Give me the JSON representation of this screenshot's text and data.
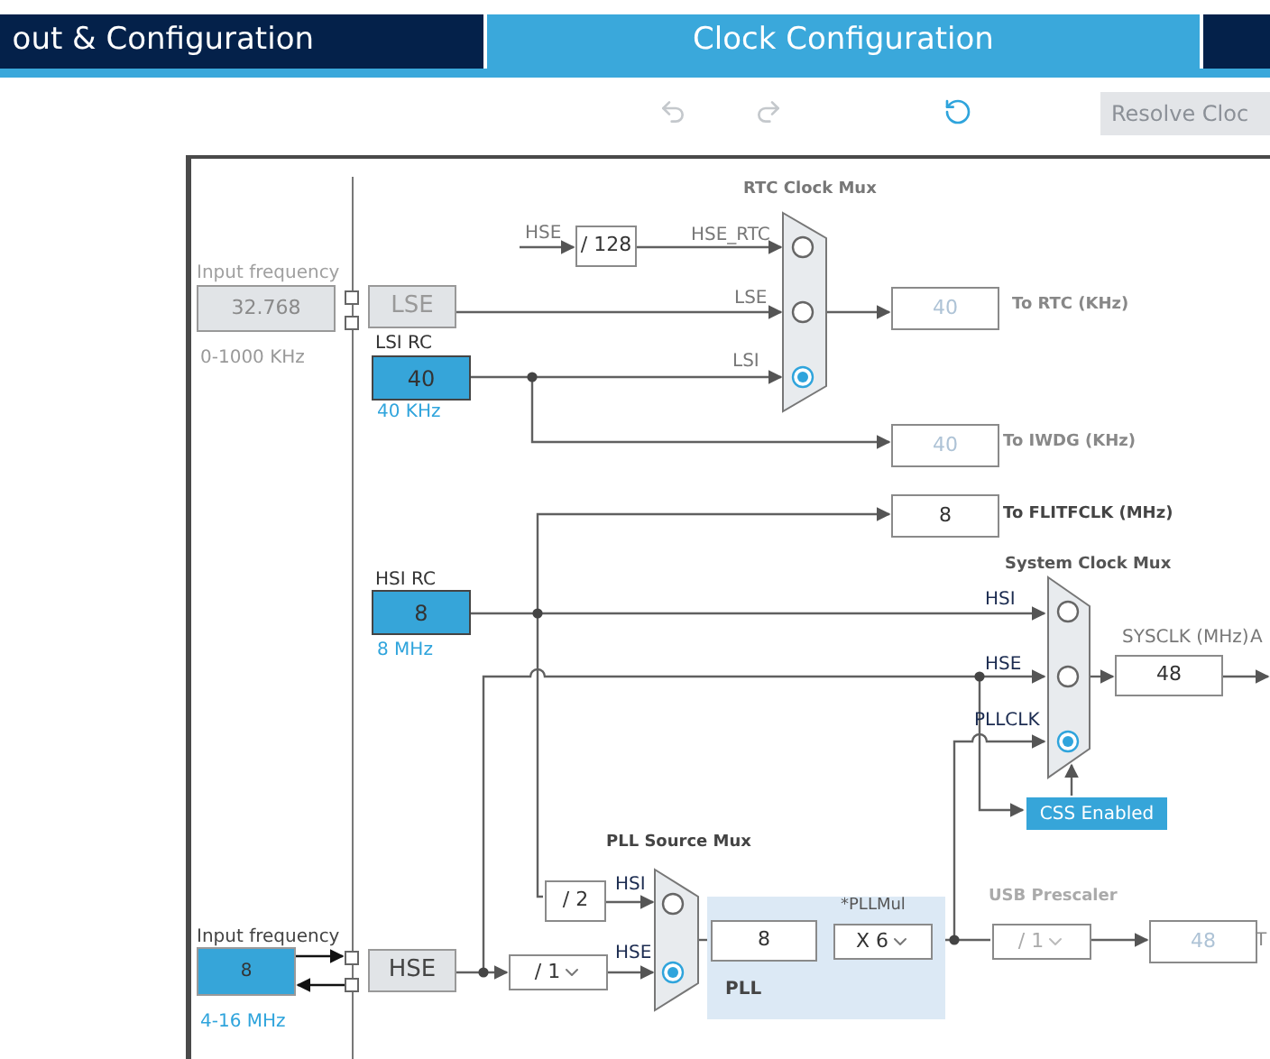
{
  "tabs": [
    {
      "label": "out & Configuration",
      "selected": false
    },
    {
      "label": "Clock Configuration",
      "selected": true
    }
  ],
  "toolbar": {
    "buttons": [
      {
        "kind": "undo",
        "disabled": true
      },
      {
        "kind": "redo",
        "disabled": true
      },
      {
        "kind": "reset",
        "disabled": false
      }
    ],
    "resolve_button": {
      "label": "Resolve Cloc",
      "disabled": true
    }
  },
  "diagram": {
    "lse_input": {
      "label": "Input frequency",
      "value": "32.768",
      "range": "0-1000 KHz",
      "disabled": true
    },
    "lse": {
      "label": "LSE",
      "disabled": true
    },
    "lsi": {
      "title": "LSI RC",
      "value": "40",
      "freq": "40 KHz"
    },
    "hse_div128": {
      "input_label": "HSE",
      "value": "/ 128"
    },
    "rtc_mux": {
      "title": "RTC Clock Mux",
      "inputs": [
        {
          "label": "HSE_RTC",
          "selected": false
        },
        {
          "label": "LSE",
          "selected": false
        },
        {
          "label": "LSI",
          "selected": true
        }
      ]
    },
    "outputs": [
      {
        "value": "40",
        "label": "To RTC (KHz)",
        "disabled": true
      },
      {
        "value": "40",
        "label": "To IWDG (KHz)",
        "disabled": true
      },
      {
        "value": "8",
        "label": "To FLITFCLK (MHz)",
        "disabled": false
      }
    ],
    "hsi": {
      "title": "HSI RC",
      "value": "8",
      "freq": "8 MHz"
    },
    "sys_mux": {
      "title": "System Clock Mux",
      "inputs": [
        {
          "label": "HSI",
          "selected": false
        },
        {
          "label": "HSE",
          "selected": false
        },
        {
          "label": "PLLCLK",
          "selected": true
        }
      ]
    },
    "sysclk": {
      "label": "SYSCLK (MHz)",
      "value": "48",
      "next_label": "A"
    },
    "css_button": {
      "label": "CSS Enabled"
    },
    "hse_input": {
      "label": "Input frequency",
      "value": "8",
      "range": "4-16 MHz"
    },
    "hse": {
      "label": "HSE"
    },
    "hsi_div2": {
      "value": "/ 2"
    },
    "hse_prediv": {
      "value": "/ 1"
    },
    "pll_mux": {
      "title": "PLL Source Mux",
      "inputs": [
        {
          "label": "HSI",
          "selected": false
        },
        {
          "label": "HSE",
          "selected": true
        }
      ]
    },
    "pll": {
      "title": "PLL",
      "input_value": "8",
      "mul_label": "*PLLMul",
      "mul_value": "X 6"
    },
    "usb": {
      "title": "USB Prescaler",
      "value": "/ 1",
      "output": "48",
      "next_label": "T",
      "disabled": true
    }
  }
}
